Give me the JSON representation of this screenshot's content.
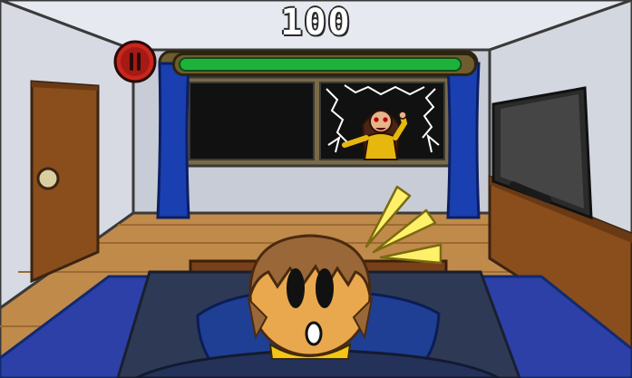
{
  "hud": {
    "score": "100",
    "health_fraction": 0.97,
    "health_color": "#1fb23a",
    "pause_icon": "pause-icon",
    "pause_color": "#c9261e"
  },
  "scene": {
    "left_window": "dark-window-pane",
    "right_window": "broken-window-with-intruder",
    "alert_icon": "alert-burst-icon"
  }
}
